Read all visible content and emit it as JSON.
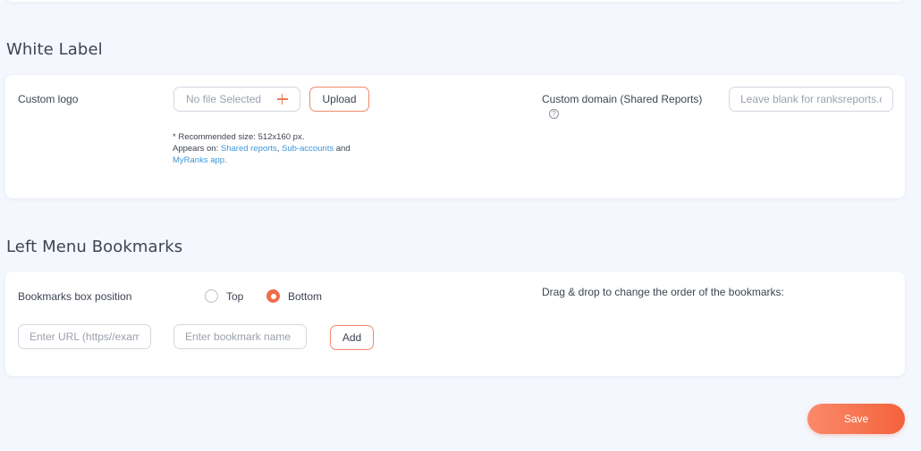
{
  "white_label": {
    "title": "White Label",
    "custom_logo_label": "Custom logo",
    "file_picker_text": "No file Selected",
    "upload_label": "Upload",
    "hint_line1": "* Recommended size: 512x160 px.",
    "hint_appears_on": "Appears on:",
    "hint_link_shared_reports": "Shared reports",
    "hint_comma": ",",
    "hint_link_sub_accounts": "Sub-accounts",
    "hint_and": "and",
    "hint_link_myranks": "MyRanks app.",
    "custom_domain_label": "Custom domain (Shared Reports)",
    "help_icon_glyph": "?",
    "custom_domain_placeholder": "Leave blank for ranksreports.c"
  },
  "bookmarks": {
    "title": "Left Menu Bookmarks",
    "position_label": "Bookmarks box position",
    "options": [
      {
        "label": "Top",
        "checked": false
      },
      {
        "label": "Bottom",
        "checked": true
      }
    ],
    "url_placeholder": "Enter URL (https//exam",
    "name_placeholder": "Enter bookmark name",
    "add_label": "Add",
    "drag_hint": "Drag & drop to change the order of the bookmarks:"
  },
  "footer": {
    "save_label": "Save"
  },
  "colors": {
    "accent": "#f4623c",
    "link": "#3f97d8",
    "background": "#f4f7fd"
  }
}
